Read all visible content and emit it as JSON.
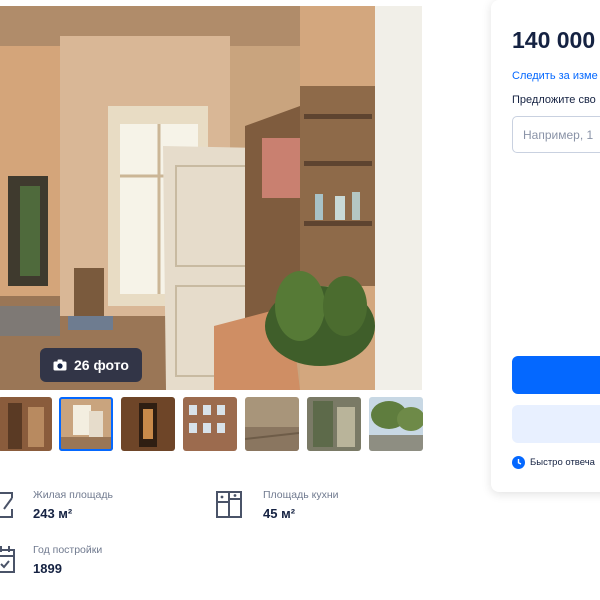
{
  "gallery": {
    "photo_count_label": "26 фото",
    "thumbnail_count": 7,
    "active_thumbnail": 2
  },
  "params": [
    {
      "icon": "area-icon",
      "label": "Жилая площадь",
      "value": "243 м²"
    },
    {
      "icon": "kitchen-icon",
      "label": "Площадь кухни",
      "value": "45 м²"
    },
    {
      "icon": "calendar-icon",
      "label": "Год постройки",
      "value": "1899"
    }
  ],
  "sidebar": {
    "price": "140 000",
    "follow_link": "Следить за изме",
    "offer_label": "Предложите сво",
    "offer_placeholder": "Например, 1",
    "fast_reply": "Быстро отвеча",
    "accent_color": "#0468ff",
    "secondary_color": "#e8f0ff"
  }
}
